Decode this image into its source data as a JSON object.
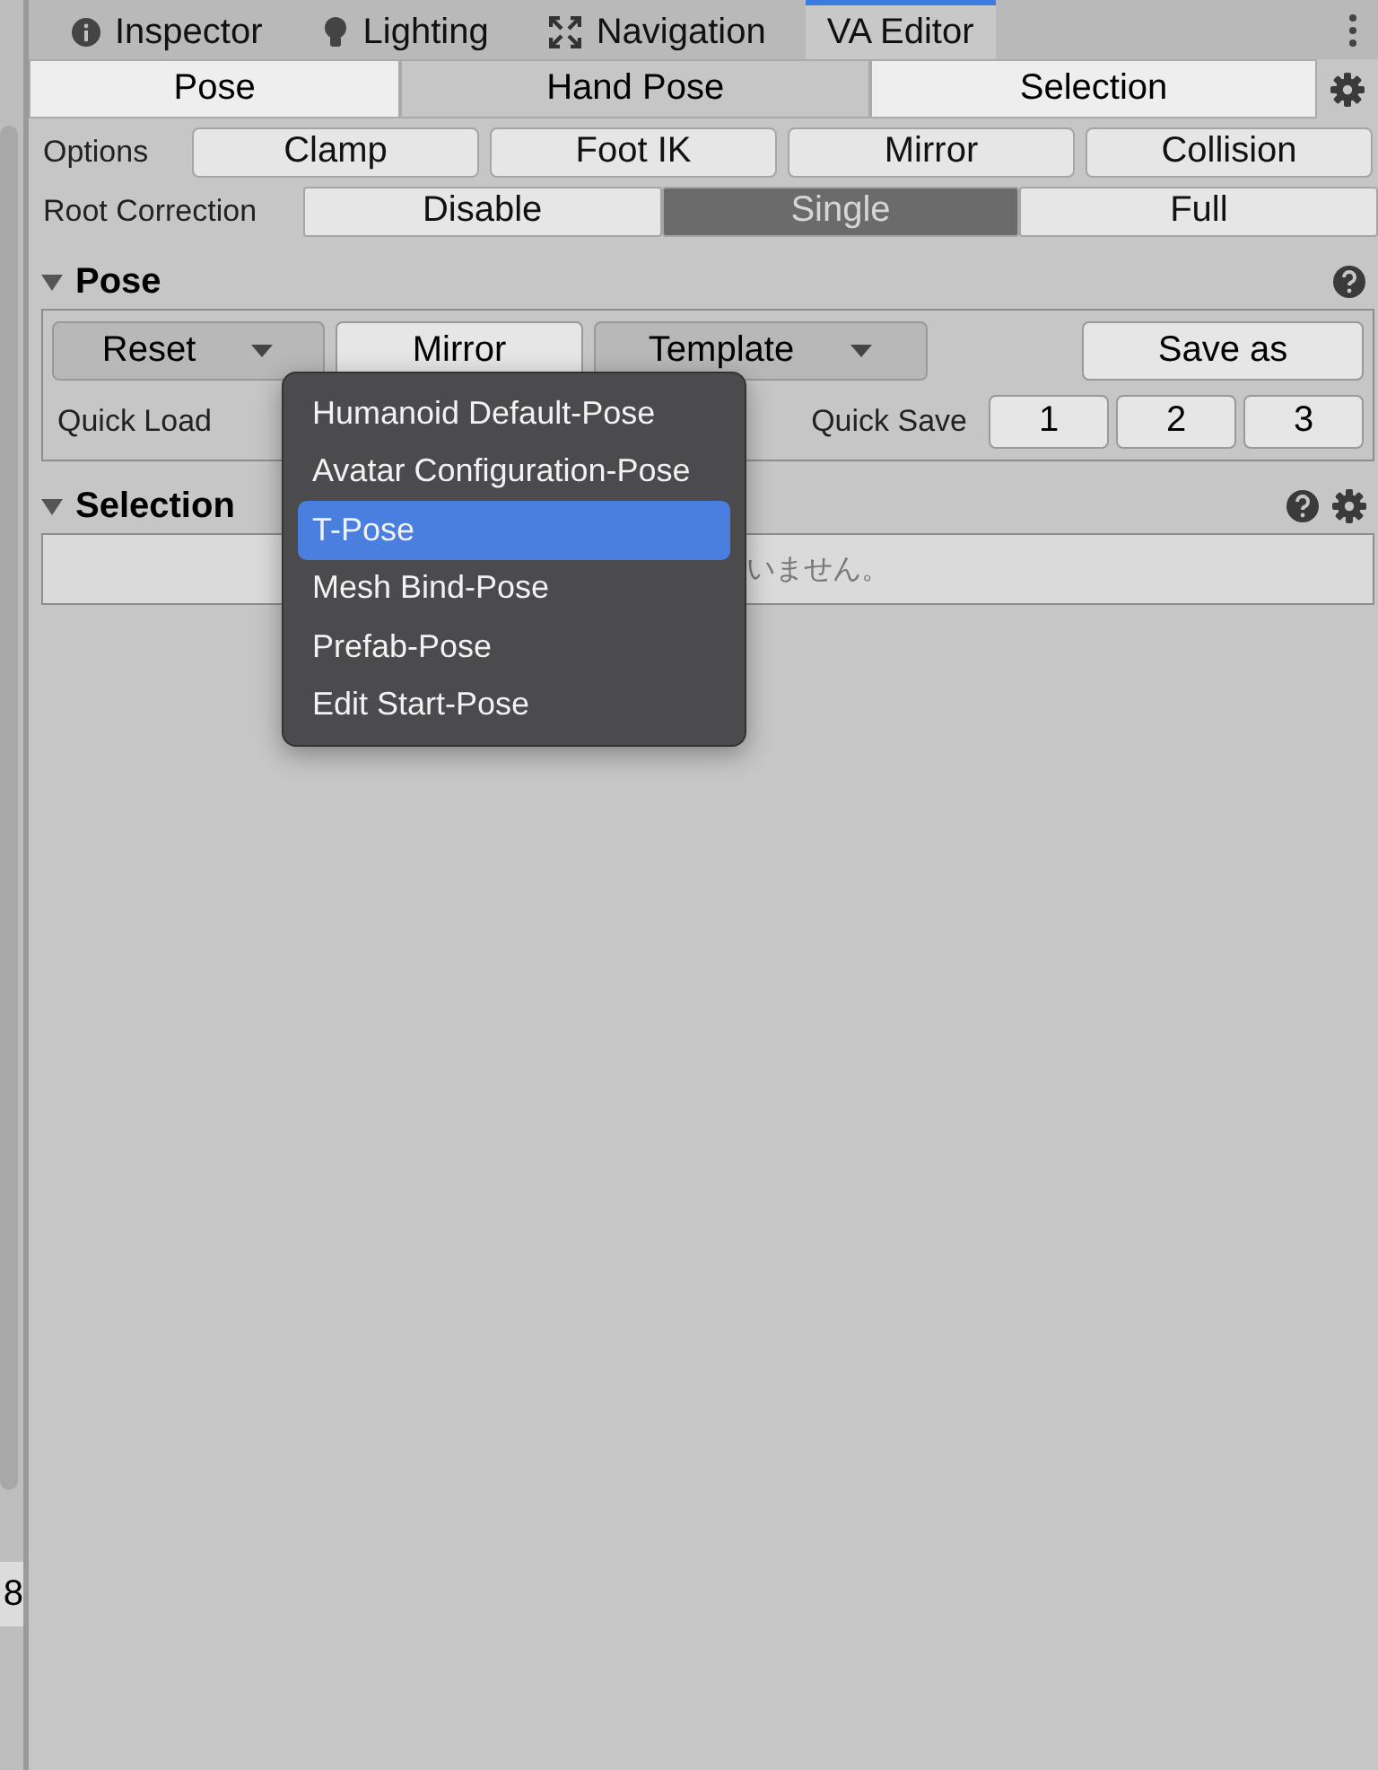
{
  "left_panel": {
    "text": "8"
  },
  "tabs": [
    {
      "label": "Inspector",
      "kind": "info",
      "selected": false
    },
    {
      "label": "Lighting",
      "kind": "bulb",
      "selected": false
    },
    {
      "label": "Navigation",
      "kind": "nav",
      "selected": false
    },
    {
      "label": "VA Editor",
      "kind": "plain",
      "selected": true
    }
  ],
  "mode_toggles": [
    {
      "label": "Pose",
      "on": true
    },
    {
      "label": "Hand Pose",
      "on": false
    },
    {
      "label": "Selection",
      "on": true
    }
  ],
  "options": {
    "label": "Options",
    "buttons": [
      {
        "label": "Clamp",
        "on": false
      },
      {
        "label": "Foot IK",
        "on": false
      },
      {
        "label": "Mirror",
        "on": false
      },
      {
        "label": "Collision",
        "on": false
      }
    ]
  },
  "root_correction": {
    "label": "Root Correction",
    "options": [
      {
        "label": "Disable",
        "selected": false
      },
      {
        "label": "Single",
        "selected": true
      },
      {
        "label": "Full",
        "selected": false
      }
    ]
  },
  "pose_section": {
    "title": "Pose",
    "expanded": true,
    "buttons": [
      {
        "label": "Reset",
        "kind": "dropdown"
      },
      {
        "label": "Mirror",
        "kind": "button"
      },
      {
        "label": "Template",
        "kind": "dropdown"
      },
      {
        "label": "Save as",
        "kind": "button"
      }
    ],
    "quick_load": "Quick Load",
    "quick_save": "Quick Save",
    "slots": [
      "1",
      "2",
      "3"
    ]
  },
  "selection_section": {
    "title": "Selection",
    "expanded": true,
    "message": "いません。"
  },
  "dropdown_menu": [
    {
      "label": "Humanoid Default-Pose",
      "selected": false
    },
    {
      "label": "Avatar Configuration-Pose",
      "selected": false
    },
    {
      "label": "T-Pose",
      "selected": true
    },
    {
      "label": "Mesh Bind-Pose",
      "selected": false
    },
    {
      "label": "Prefab-Pose",
      "selected": false
    },
    {
      "label": "Edit Start-Pose",
      "selected": false
    }
  ]
}
